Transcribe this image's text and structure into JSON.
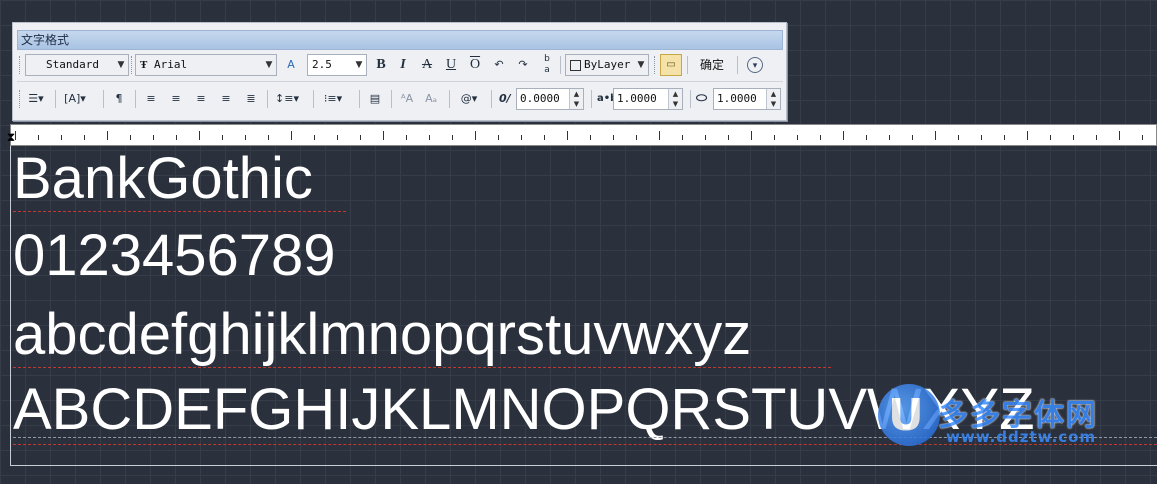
{
  "toolbar": {
    "title": "文字格式",
    "style_value": "Standard",
    "font_value": "Arial",
    "font_prefix_icon": "Ŧ",
    "height_value": "2.5",
    "color_value": "ByLayer",
    "ok_label": "确定",
    "oblique_value": "0.0000",
    "tracking_value": "1.0000",
    "width_value": "1.0000",
    "tracking_label": "a•b",
    "oblique_label": "0/"
  },
  "editor": {
    "lines": [
      "BankGothic",
      "0123456789",
      "abcdefghijklmnopqrstuvwxyz",
      "ABCDEFGHIJKLMNOPQRSTUVWXYZ"
    ]
  },
  "watermark": {
    "logo_letter": "U",
    "name": "多多字体网",
    "url": "www.ddztw.com"
  }
}
